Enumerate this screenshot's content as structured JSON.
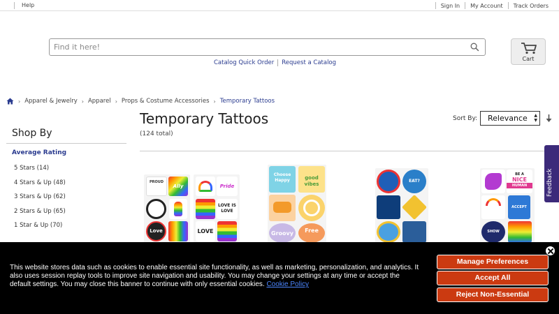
{
  "topbar": {
    "help": "Help",
    "links": [
      "Sign In",
      "My Account",
      "Track Orders"
    ]
  },
  "search": {
    "placeholder": "Find it here!",
    "icon": "search-icon"
  },
  "quicklinks": {
    "quick_order": "Catalog Quick Order",
    "request_catalog": "Request a Catalog"
  },
  "cart": {
    "label": "Cart",
    "icon": "cart-icon"
  },
  "breadcrumb": {
    "home_icon": "home-icon",
    "items": [
      "Apparel & Jewelry",
      "Apparel",
      "Props & Costume Accessories"
    ],
    "current": "Temporary Tattoos"
  },
  "sidebar": {
    "heading": "Shop By",
    "facet_title": "Average Rating",
    "ratings": [
      "5 Stars (14)",
      "4 Stars & Up (48)",
      "3 Stars & Up (62)",
      "2 Stars & Up (65)",
      "1 Star & Up (70)"
    ]
  },
  "main": {
    "title": "Temporary Tattoos",
    "total": "(124 total)",
    "sort_label": "Sort By:",
    "sort_value": "Relevance",
    "sort_dir_icon": "sort-direction-icon"
  },
  "feedback": {
    "label": "Feedback"
  },
  "products": [
    {
      "name": "pride-tattoos",
      "texts": [
        "PROUD",
        "Ally",
        "Pride",
        "LOVE IS LOVE",
        "Love",
        "LOVE"
      ]
    },
    {
      "name": "good-vibes-tattoos",
      "texts": [
        "Choose Happy",
        "good vibes",
        "Groovy",
        "Free"
      ]
    },
    {
      "name": "shark-tattoos",
      "texts": [
        "EAT?"
      ]
    },
    {
      "name": "kindness-tattoos",
      "texts": [
        "BE A",
        "NICE",
        "HUMAN",
        "ACCEPT",
        "SHOW"
      ]
    }
  ],
  "colors": {
    "link": "#2a3b8f",
    "cookie_bg": "#000000",
    "cookie_button": "#cb3a11",
    "feedback_tab": "#3c2a7a"
  },
  "cookie": {
    "message": "This website stores data such as cookies to enable essential site functionality, as well as marketing, personalization, and analytics. It also uses session replay tools to improve site navigation and usability. You may change your settings at any time or accept the default settings. You may close this banner to continue with only essential cookies.",
    "policy_link": "Cookie Policy",
    "buttons": {
      "manage": "Manage Preferences",
      "accept": "Accept All",
      "reject": "Reject Non-Essential"
    },
    "close_icon": "close-icon"
  }
}
